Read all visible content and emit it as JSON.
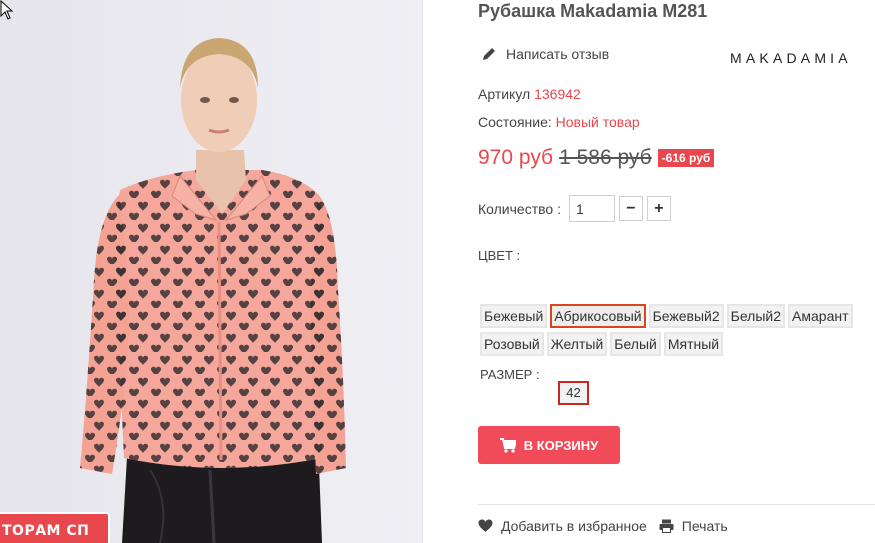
{
  "product": {
    "title": "Рубашка Makadamia M281",
    "brand_logo_text": "MAKADAMIA"
  },
  "review": {
    "label": "Написать отзыв",
    "icon": "pencil-icon"
  },
  "sku": {
    "label": "Артикул",
    "value": "136942"
  },
  "condition": {
    "label": "Состояние:",
    "value": "Новый товар"
  },
  "price": {
    "current": "970 руб",
    "old": "1 586 руб",
    "discount": "-616 руб"
  },
  "quantity": {
    "label": "Количество :",
    "value": "1",
    "minus": "−",
    "plus": "+"
  },
  "color": {
    "heading": "ЦВЕТ :",
    "selected": "Абрикосовый",
    "options": [
      [
        "Бежевый",
        "Абрикосовый",
        "Бежевый2",
        "Белый2",
        "Амарант"
      ],
      [
        "Розовый",
        "Желтый",
        "Белый",
        "Мятный"
      ]
    ]
  },
  "size": {
    "heading": "РАЗМЕР :",
    "options": [
      "42"
    ],
    "selected": "42"
  },
  "cart": {
    "label": "В КОРЗИНУ",
    "icon": "cart-icon"
  },
  "links": {
    "favorite": {
      "label": "Добавить в избранное",
      "icon": "heart-icon"
    },
    "print": {
      "label": "Печать",
      "icon": "printer-icon"
    }
  },
  "promo_tab": {
    "label": "ТОРАМ СП"
  },
  "colors": {
    "accent": "#e8474e",
    "cart_button": "#f14b5a",
    "selected_border": "#d9451c"
  }
}
